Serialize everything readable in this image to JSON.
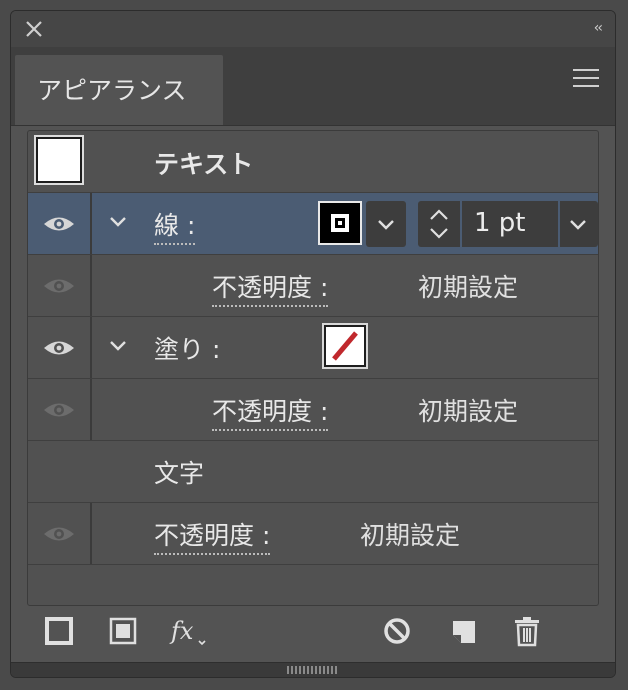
{
  "panel": {
    "tab_label": "アピアランス"
  },
  "rows": {
    "object": {
      "label": "テキスト"
    },
    "stroke": {
      "label": "線 :",
      "weight_value": "1 pt"
    },
    "stroke_opacity": {
      "label": "不透明度 :",
      "value": "初期設定"
    },
    "fill": {
      "label": "塗り :"
    },
    "fill_opacity": {
      "label": "不透明度 :",
      "value": "初期設定"
    },
    "characters": {
      "label": "文字"
    },
    "object_opacity": {
      "label": "不透明度 :",
      "value": "初期設定"
    }
  },
  "colors": {
    "panel_bg": "#535353",
    "selected_row": "#4b5c73",
    "fill_slash": "#c0282d"
  },
  "icons": [
    "close-icon",
    "collapse-icon",
    "panel-menu-icon",
    "eye-icon",
    "chevron-down-icon",
    "stepper-icon",
    "add-stroke-icon",
    "add-fill-icon",
    "fx-icon",
    "clear-appearance-icon",
    "duplicate-item-icon",
    "trash-icon",
    "resize-grip-icon"
  ]
}
